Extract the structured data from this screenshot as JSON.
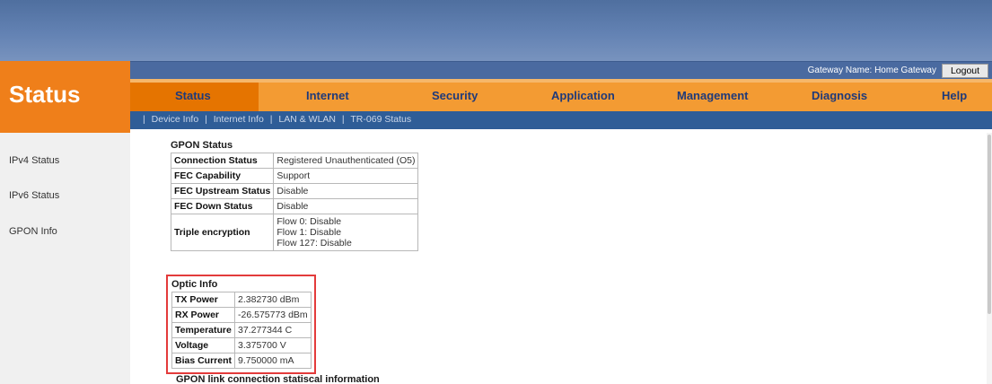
{
  "brand": {
    "title": "Status"
  },
  "gateway": {
    "name": "Gateway Name: Home Gateway",
    "logout": "Logout"
  },
  "menu": [
    "Status",
    "Internet",
    "Security",
    "Application",
    "Management",
    "Diagnosis",
    "Help"
  ],
  "submenu": [
    "Device Info",
    "Internet Info",
    "LAN & WLAN",
    "TR-069 Status"
  ],
  "sidebar": [
    "IPv4 Status",
    "IPv6 Status",
    "GPON Info"
  ],
  "gpon": {
    "title": "GPON Status",
    "rows": [
      {
        "k": "Connection Status",
        "v": "Registered Unauthenticated (O5)"
      },
      {
        "k": "FEC Capability",
        "v": "Support"
      },
      {
        "k": "FEC Upstream Status",
        "v": "Disable"
      },
      {
        "k": "FEC Down Status",
        "v": "Disable"
      }
    ],
    "triple_label": "Triple encryption",
    "triple_values": [
      "Flow 0: Disable",
      "Flow 1: Disable",
      "Flow 127: Disable"
    ]
  },
  "optic": {
    "title": "Optic Info",
    "rows": [
      {
        "k": "TX Power",
        "v": "2.382730 dBm"
      },
      {
        "k": "RX Power",
        "v": "-26.575773 dBm"
      },
      {
        "k": "Temperature",
        "v": "37.277344 C"
      },
      {
        "k": "Voltage",
        "v": "3.375700 V"
      },
      {
        "k": "Bias Current",
        "v": "9.750000 mA"
      }
    ]
  },
  "footer": {
    "title": "GPON link connection statiscal information"
  },
  "colors": {
    "orange": "#ef7f1a",
    "menu_text": "#1f3a7a",
    "highlight": "#e33b3b"
  }
}
